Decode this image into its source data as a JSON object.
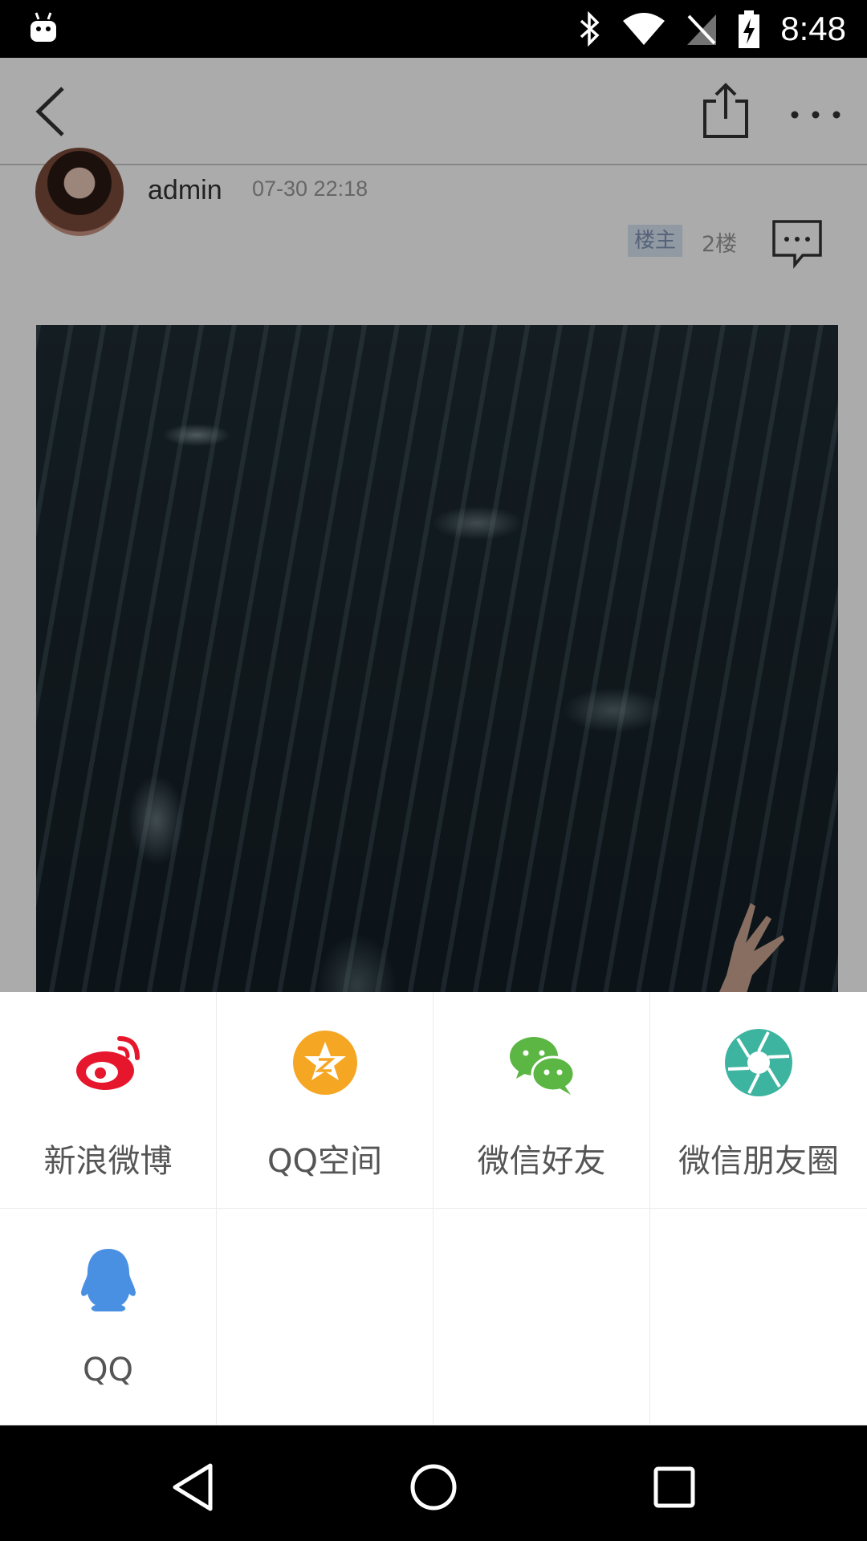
{
  "status_bar": {
    "time": "8:48",
    "icons": [
      "android-icon",
      "bluetooth-icon",
      "wifi-icon",
      "no-signal-icon",
      "battery-charging-icon"
    ]
  },
  "toolbar": {
    "icons": [
      "back-icon",
      "share-icon",
      "more-icon"
    ]
  },
  "post": {
    "username": "admin",
    "time": "07-30 22:18",
    "owner_badge": "楼主",
    "floor": "2楼"
  },
  "share_sheet": {
    "items": [
      {
        "label": "新浪微博",
        "icon": "weibo-icon",
        "color": "#e6162d"
      },
      {
        "label": "QQ空间",
        "icon": "qzone-icon",
        "color": "#f5a623"
      },
      {
        "label": "微信好友",
        "icon": "wechat-icon",
        "color": "#5bb643"
      },
      {
        "label": "微信朋友圈",
        "icon": "moments-icon",
        "color": "#3cb4a0"
      },
      {
        "label": "QQ",
        "icon": "qq-icon",
        "color": "#4a90e2"
      }
    ]
  },
  "nav_bar": {
    "icons": [
      "nav-back-icon",
      "nav-home-icon",
      "nav-recents-icon"
    ]
  }
}
